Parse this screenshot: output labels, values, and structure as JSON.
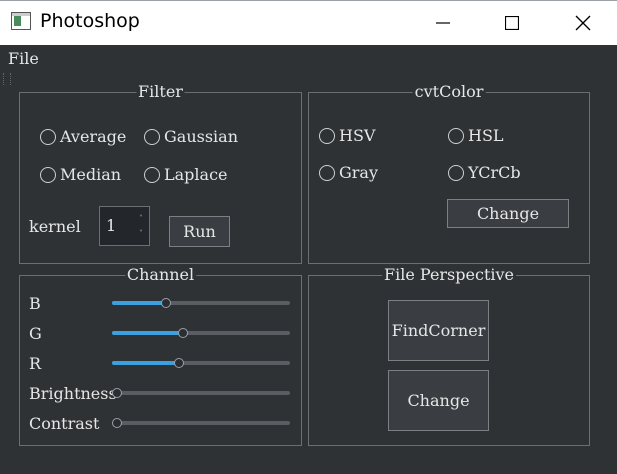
{
  "window": {
    "title": "Photoshop"
  },
  "menu": {
    "file": "File"
  },
  "filter": {
    "title": "Filter",
    "options": [
      "Average",
      "Gaussian",
      "Median",
      "Laplace"
    ],
    "kernel_label": "kernel",
    "kernel_value": "1",
    "run_label": "Run"
  },
  "cvtcolor": {
    "title": "cvtColor",
    "options": [
      "HSV",
      "HSL",
      "Gray",
      "YCrCb"
    ],
    "change_label": "Change"
  },
  "channel": {
    "title": "Channel",
    "sliders": [
      {
        "label": "B",
        "value": 0.29
      },
      {
        "label": "G",
        "value": 0.39
      },
      {
        "label": "R",
        "value": 0.37
      },
      {
        "label": "Brightness",
        "value": 0.0
      },
      {
        "label": "Contrast",
        "value": 0.0
      }
    ]
  },
  "perspective": {
    "title": "File Perspective",
    "findcorner_label": "FindCorner",
    "change_label": "Change"
  },
  "colors": {
    "accent": "#3aa0e0",
    "background": "#2f3235"
  }
}
